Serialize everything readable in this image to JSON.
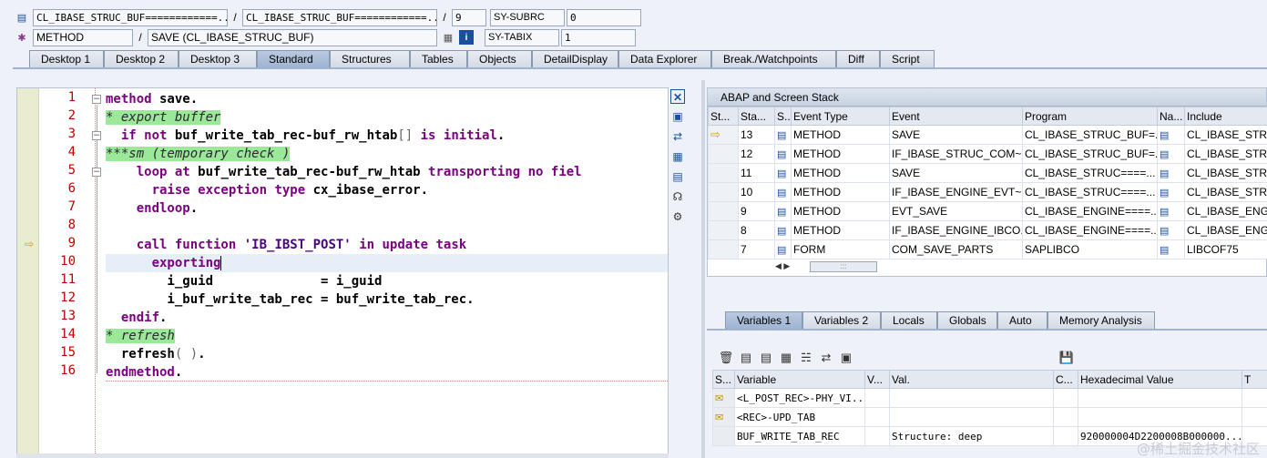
{
  "header": {
    "program_field": "CL_IBASE_STRUC_BUF============...",
    "include_field": "CL_IBASE_STRUC_BUF============...",
    "line_field": "9",
    "sy_subrc_label": "SY-SUBRC",
    "sy_subrc_value": "0",
    "event_type_field": "METHOD",
    "event_field": "SAVE (CL_IBASE_STRUC_BUF)",
    "sy_tabix_label": "SY-TABIX",
    "sy_tabix_value": "1",
    "slash": "/"
  },
  "tabs": [
    "Desktop 1",
    "Desktop 2",
    "Desktop 3",
    "Standard",
    "Structures",
    "Tables",
    "Objects",
    "DetailDisplay",
    "Data Explorer",
    "Break./Watchpoints",
    "Diff",
    "Script"
  ],
  "active_tab": "Standard",
  "editor": {
    "line_numbers": [
      "1",
      "2",
      "3",
      "4",
      "5",
      "6",
      "7",
      "8",
      "9",
      "10",
      "11",
      "12",
      "13",
      "14",
      "15",
      "16"
    ],
    "current_line": 9,
    "lines": [
      "method save.",
      "* export buffer",
      "  if not buf_write_tab_rec-buf_rw_htab[] is initial.",
      "***sm (temporary check )",
      "    loop at buf_write_tab_rec-buf_rw_htab transporting no fiel",
      "      raise exception type cx_ibase_error.",
      "    endloop.",
      "",
      "    call function 'IB_IBST_POST' in update task",
      "      exporting",
      "        i_guid             = i_guid",
      "        i_buf_write_tab_rec = buf_write_tab_rec.",
      "  endif.",
      "* refresh",
      "  refresh( ).",
      "endmethod."
    ]
  },
  "stack": {
    "title": "ABAP and Screen Stack",
    "columns": [
      "St...",
      "Sta...",
      "S...",
      "Event Type",
      "Event",
      "Program",
      "Na...",
      "Include"
    ],
    "rows": [
      {
        "level": "13",
        "type": "METHOD",
        "event": "SAVE",
        "program": "CL_IBASE_STRUC_BUF=...",
        "include": "CL_IBASE_STRUC",
        "current": true
      },
      {
        "level": "12",
        "type": "METHOD",
        "event": "IF_IBASE_STRUC_COM~...",
        "program": "CL_IBASE_STRUC_BUF=...",
        "include": "CL_IBASE_STRUC",
        "current": false
      },
      {
        "level": "11",
        "type": "METHOD",
        "event": "SAVE",
        "program": "CL_IBASE_STRUC====...",
        "include": "CL_IBASE_STRUC",
        "current": false
      },
      {
        "level": "10",
        "type": "METHOD",
        "event": "IF_IBASE_ENGINE_EVT~...",
        "program": "CL_IBASE_STRUC====...",
        "include": "CL_IBASE_STRUC",
        "current": false
      },
      {
        "level": "9",
        "type": "METHOD",
        "event": "EVT_SAVE",
        "program": "CL_IBASE_ENGINE====...",
        "include": "CL_IBASE_ENGIN",
        "current": false
      },
      {
        "level": "8",
        "type": "METHOD",
        "event": "IF_IBASE_ENGINE_IBCO...",
        "program": "CL_IBASE_ENGINE====...",
        "include": "CL_IBASE_ENGIN",
        "current": false
      },
      {
        "level": "7",
        "type": "FORM",
        "event": "COM_SAVE_PARTS",
        "program": "SAPLIBCO",
        "include": "LIBCOF75",
        "current": false
      }
    ]
  },
  "lower_tabs": [
    "Variables 1",
    "Variables 2",
    "Locals",
    "Globals",
    "Auto",
    "Memory Analysis"
  ],
  "active_lower_tab": "Variables 1",
  "variables": {
    "columns": [
      "S...",
      "Variable",
      "V...",
      "Val.",
      "C...",
      "Hexadecimal Value",
      "T"
    ],
    "rows": [
      {
        "variable": "<L_POST_REC>-PHY_VI...",
        "value": "",
        "hex": "",
        "locked": true
      },
      {
        "variable": "<REC>-UPD_TAB",
        "value": "",
        "hex": "",
        "locked": true
      },
      {
        "variable": "BUF_WRITE_TAB_REC",
        "value": "Structure: deep",
        "hex": "920000004D2200008B000000...",
        "locked": false
      }
    ]
  },
  "watermark": "@稀土掘金技术社区"
}
